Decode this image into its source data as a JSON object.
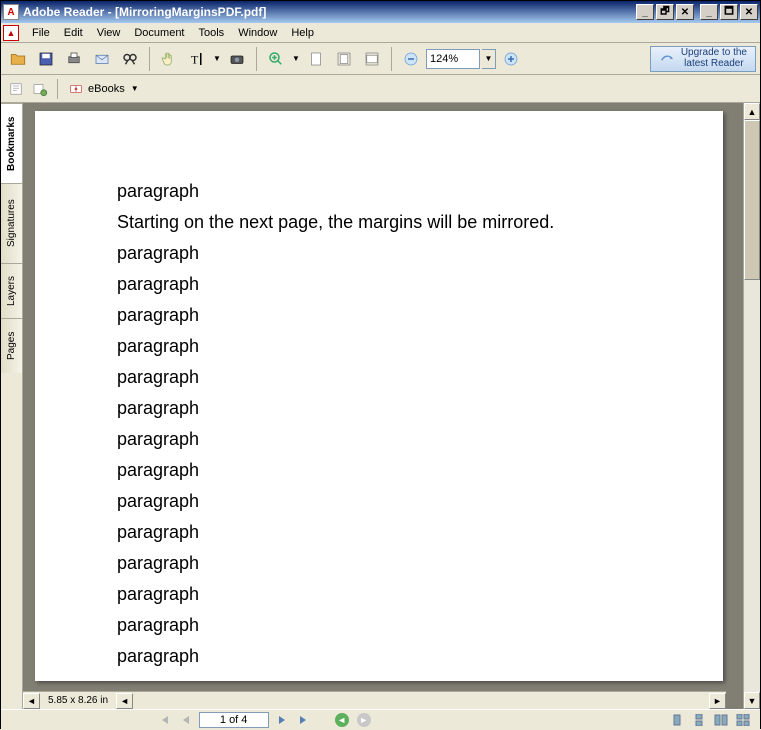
{
  "window": {
    "title": "Adobe Reader - [MirroringMarginsPDF.pdf]"
  },
  "menu": {
    "file": "File",
    "edit": "Edit",
    "view": "View",
    "document": "Document",
    "tools": "Tools",
    "window": "Window",
    "help": "Help"
  },
  "toolbar": {
    "zoom_value": "124%",
    "upgrade_line1": "Upgrade to the",
    "upgrade_line2": "latest Reader"
  },
  "secondary": {
    "ebooks_label": "eBooks"
  },
  "nav": {
    "bookmarks": "Bookmarks",
    "signatures": "Signatures",
    "layers": "Layers",
    "pages": "Pages"
  },
  "document": {
    "lines": [
      "paragraph",
      "Starting on the next page, the margins will be mirrored.",
      "paragraph",
      "paragraph",
      "paragraph",
      "paragraph",
      "paragraph",
      "paragraph",
      "paragraph",
      "paragraph",
      "paragraph",
      "paragraph",
      "paragraph",
      "paragraph",
      "paragraph",
      "paragraph"
    ]
  },
  "status": {
    "dimensions": "5.85 x 8.26 in"
  },
  "footer": {
    "page_display": "1 of 4"
  }
}
